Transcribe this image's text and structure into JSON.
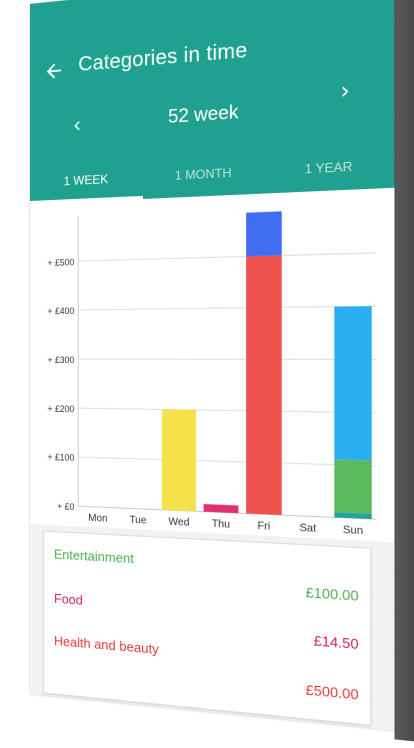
{
  "header": {
    "title": "Categories in time",
    "period": "52 week"
  },
  "tabs": [
    {
      "label": "1 WEEK",
      "active": true
    },
    {
      "label": "1 MONTH",
      "active": false
    },
    {
      "label": "1 YEAR",
      "active": false
    }
  ],
  "colors": {
    "primary": "#20a190",
    "blue": "#3f6ff0",
    "red": "#ef5350",
    "yellow": "#f5e14a",
    "pink": "#e0306f",
    "lightblue": "#29aef0",
    "green": "#5cb85c",
    "teal": "#1fa39c"
  },
  "chart_data": {
    "type": "bar",
    "categories": [
      "Mon",
      "Tue",
      "Wed",
      "Thu",
      "Fri",
      "Sat",
      "Sun"
    ],
    "y_tick_labels": [
      "+ £0",
      "+ £100",
      "+ £200",
      "+ £300",
      "+ £400",
      "+ £500"
    ],
    "ylim": [
      0,
      600
    ],
    "stacks": [
      [],
      [],
      [
        {
          "value": 200,
          "color": "yellow"
        }
      ],
      [
        {
          "value": 15,
          "color": "pink"
        }
      ],
      [
        {
          "value": 500,
          "color": "red"
        },
        {
          "value": 85,
          "color": "blue"
        }
      ],
      [],
      [
        {
          "value": 10,
          "color": "teal"
        },
        {
          "value": 100,
          "color": "green"
        },
        {
          "value": 290,
          "color": "lightblue"
        }
      ]
    ]
  },
  "legend": [
    {
      "name": "Entertainment",
      "amount": "£100.00",
      "color": "#4caf50"
    },
    {
      "name": "Food",
      "amount": "£14.50",
      "color": "#d81b60"
    },
    {
      "name": "Health and beauty",
      "amount": "£500.00",
      "color": "#e53935"
    }
  ]
}
